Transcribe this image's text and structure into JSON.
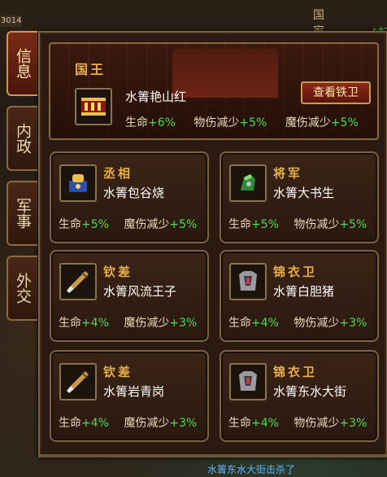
{
  "game": {
    "corner_text": "3014",
    "top_title": "国 家",
    "chat_bracket": "[起",
    "bottom_chat": "水箐东水大街击杀了"
  },
  "tabs": [
    {
      "label": "信息",
      "active": true
    },
    {
      "label": "内政",
      "active": false
    },
    {
      "label": "军事",
      "active": false
    },
    {
      "label": "外交",
      "active": false
    }
  ],
  "king": {
    "title": "国王",
    "name": "水箐艳山红",
    "icon": "book-icon",
    "button": "查看铁卫",
    "stats": [
      {
        "label": "生命",
        "value": "+6%"
      },
      {
        "label": "物伤减少",
        "value": "+5%"
      },
      {
        "label": "魔伤减少",
        "value": "+5%"
      }
    ]
  },
  "officers": [
    {
      "role": "丞相",
      "name": "水箐包谷烧",
      "icon": "seal-icon",
      "stats": [
        {
          "label": "生命",
          "value": "+5%"
        },
        {
          "label": "魔伤减少",
          "value": "+5%"
        }
      ]
    },
    {
      "role": "将军",
      "name": "水箐大书生",
      "icon": "gauntlet-icon",
      "stats": [
        {
          "label": "生命",
          "value": "+5%"
        },
        {
          "label": "物伤减少",
          "value": "+5%"
        }
      ]
    },
    {
      "role": "钦差",
      "name": "水箐风流王子",
      "icon": "brush-icon",
      "stats": [
        {
          "label": "生命",
          "value": "+4%"
        },
        {
          "label": "魔伤减少",
          "value": "+3%"
        }
      ]
    },
    {
      "role": "锦衣卫",
      "name": "水箐白胆猪",
      "icon": "armor-icon",
      "stats": [
        {
          "label": "生命",
          "value": "+4%"
        },
        {
          "label": "物伤减少",
          "value": "+3%"
        }
      ]
    },
    {
      "role": "钦差",
      "name": "水箐岩青岗",
      "icon": "brush-icon",
      "stats": [
        {
          "label": "生命",
          "value": "+4%"
        },
        {
          "label": "魔伤减少",
          "value": "+3%"
        }
      ]
    },
    {
      "role": "锦衣卫",
      "name": "水箐东水大街",
      "icon": "armor-icon",
      "stats": [
        {
          "label": "生命",
          "value": "+4%"
        },
        {
          "label": "物伤减少",
          "value": "+3%"
        }
      ]
    }
  ],
  "colors": {
    "gold": "#e9b04a",
    "green": "#4fdc4f",
    "frame": "#8a6a40"
  }
}
